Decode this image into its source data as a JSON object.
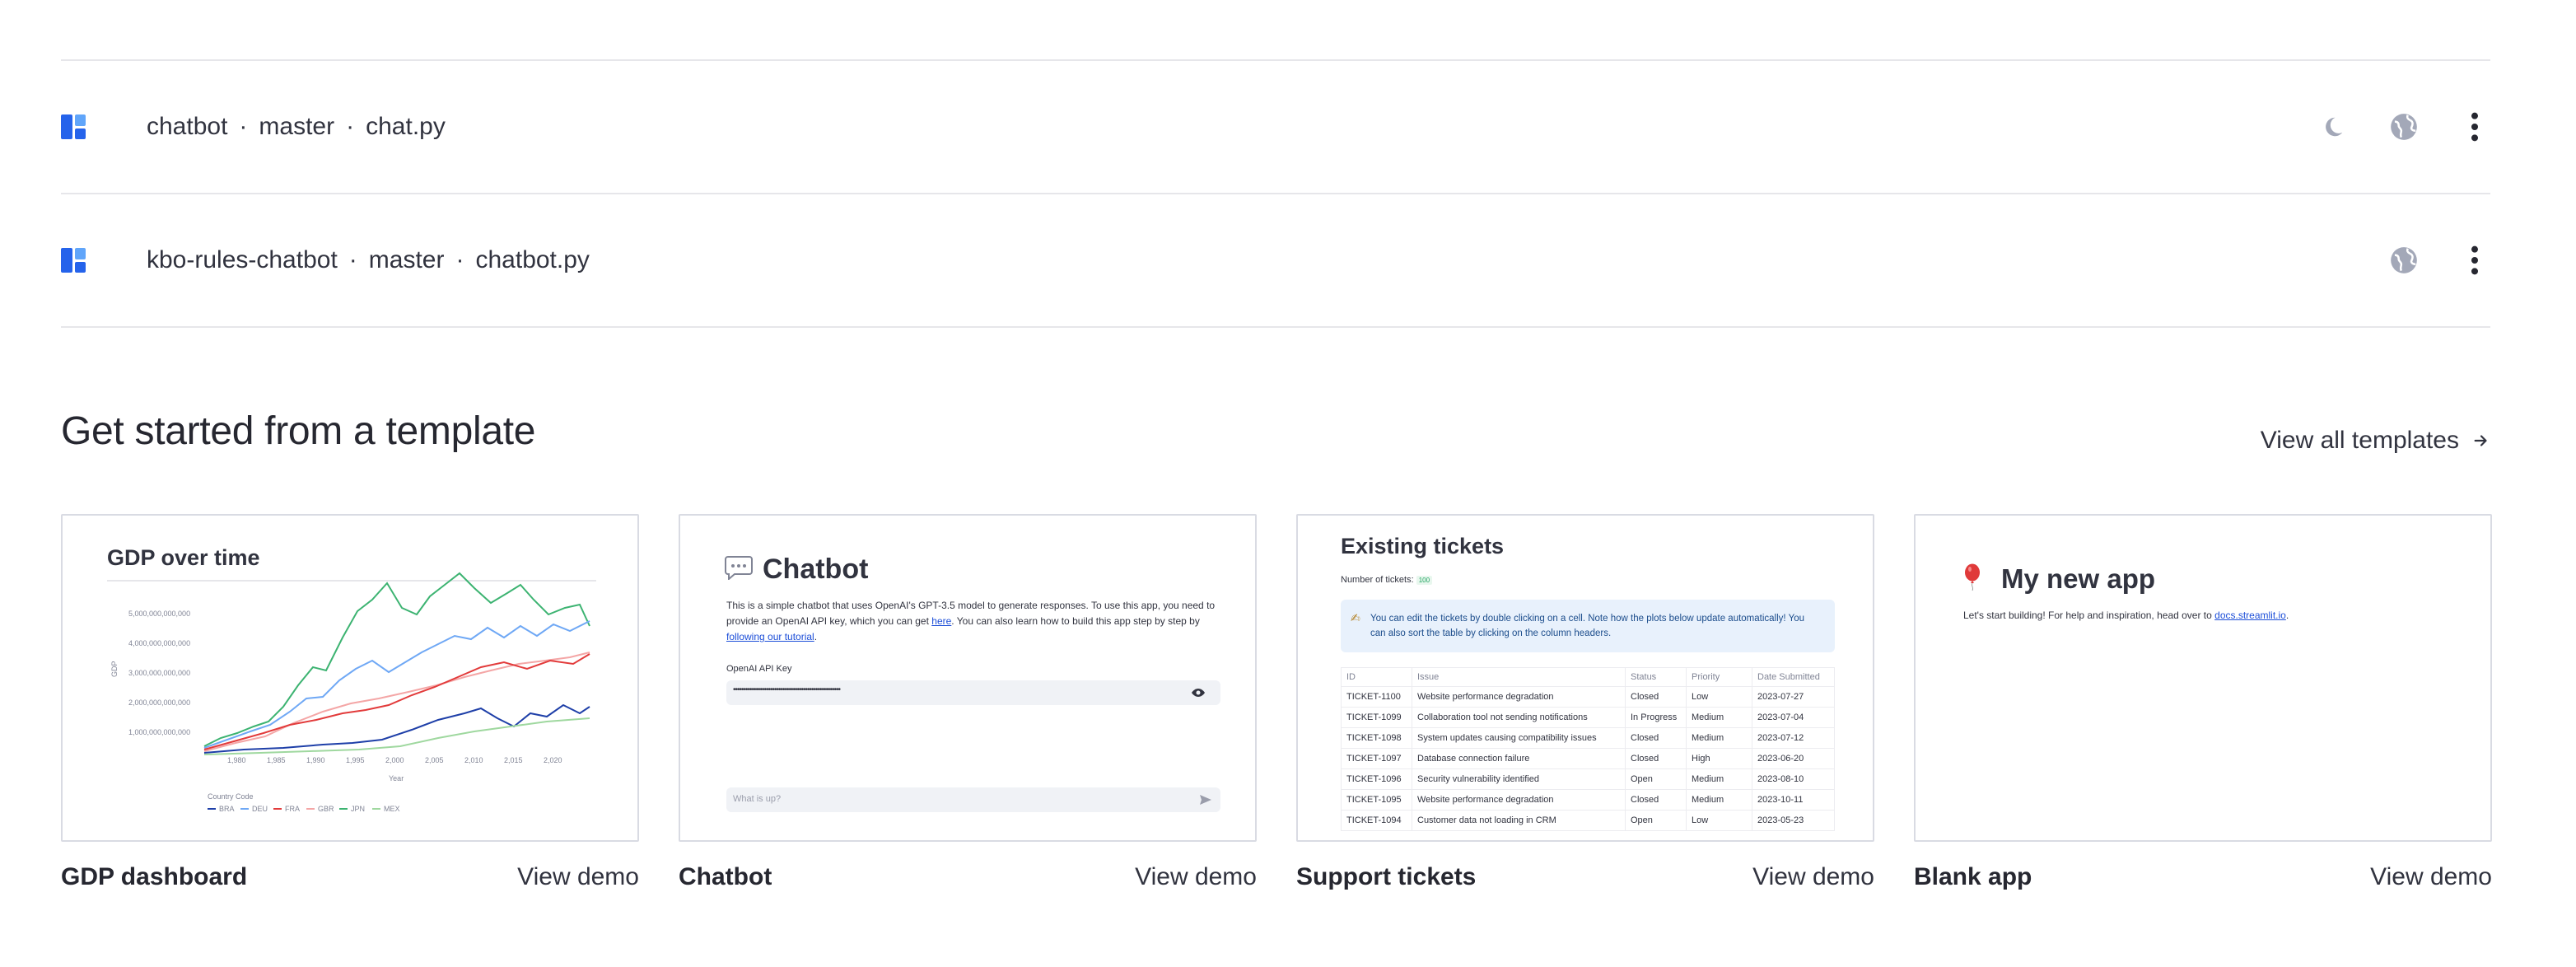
{
  "apps": [
    {
      "repo": "chatbot",
      "branch": "master",
      "file": "chat.py",
      "icons": [
        "sleep-moon-icon",
        "globe-icon",
        "more-vertical-icon"
      ]
    },
    {
      "repo": "kbo-rules-chatbot",
      "branch": "master",
      "file": "chatbot.py",
      "icons": [
        "globe-icon",
        "more-vertical-icon"
      ]
    }
  ],
  "separator": "·",
  "templates_section": {
    "title": "Get started from a template",
    "view_all_label": "View all templates",
    "view_all_icon": "arrow-right-icon"
  },
  "colors": {
    "app_icon": "#3b82f6",
    "icon_gray": "#a3a8b8",
    "link": "#1c4ed8"
  },
  "templates": [
    {
      "name": "GDP dashboard",
      "demo_label": "View demo",
      "preview": {
        "heading": "GDP over time",
        "ylabel": "GDP",
        "xlabel": "Year",
        "legend_title": "Country Code",
        "legend": [
          "BRA",
          "DEU",
          "FRA",
          "GBR",
          "JPN",
          "MEX"
        ],
        "yticks": [
          "5,000,000,000,000",
          "4,000,000,000,000",
          "3,000,000,000,000",
          "2,000,000,000,000",
          "1,000,000,000,000"
        ],
        "xticks": [
          "1,980",
          "1,985",
          "1,990",
          "1,995",
          "2,000",
          "2,005",
          "2,010",
          "2,015",
          "2,020"
        ]
      }
    },
    {
      "name": "Chatbot",
      "demo_label": "View demo",
      "preview": {
        "heading": "Chatbot",
        "heading_icon": "speech-bubble-icon",
        "text_1": "This is a simple chatbot that uses OpenAI's GPT-3.5 model to generate responses. To use this app, you need to provide an OpenAI API key, which you can get ",
        "link_1": "here",
        "text_2": ". You can also learn how to build this app step by step by ",
        "link_2": "following our tutorial",
        "text_3": ".",
        "key_label": "OpenAI API Key",
        "key_value": "••••••••••••••••••••••••••••••••••••••••••••••••••••",
        "chat_placeholder": "What is up?"
      }
    },
    {
      "name": "Support tickets",
      "demo_label": "View demo",
      "preview": {
        "heading": "Existing tickets",
        "count_label": "Number of tickets:",
        "count_value": "100",
        "info": "You can edit the tickets by double clicking on a cell. Note how the plots below update automatically! You can also sort the table by clicking on the column headers.",
        "columns": [
          "ID",
          "Issue",
          "Status",
          "Priority",
          "Date Submitted"
        ],
        "rows": [
          [
            "TICKET-1100",
            "Website performance degradation",
            "Closed",
            "Low",
            "2023-07-27"
          ],
          [
            "TICKET-1099",
            "Collaboration tool not sending notifications",
            "In Progress",
            "Medium",
            "2023-07-04"
          ],
          [
            "TICKET-1098",
            "System updates causing compatibility issues",
            "Closed",
            "Medium",
            "2023-07-12"
          ],
          [
            "TICKET-1097",
            "Database connection failure",
            "Closed",
            "High",
            "2023-06-20"
          ],
          [
            "TICKET-1096",
            "Security vulnerability identified",
            "Open",
            "Medium",
            "2023-08-10"
          ],
          [
            "TICKET-1095",
            "Website performance degradation",
            "Closed",
            "Medium",
            "2023-10-11"
          ],
          [
            "TICKET-1094",
            "Customer data not loading in CRM",
            "Open",
            "Low",
            "2023-05-23"
          ]
        ]
      }
    },
    {
      "name": "Blank app",
      "demo_label": "View demo",
      "preview": {
        "heading": "My new app",
        "heading_icon": "balloon-icon",
        "text": "Let's start building! For help and inspiration, head over to ",
        "link": "docs.streamlit.io",
        "text_end": "."
      }
    }
  ]
}
